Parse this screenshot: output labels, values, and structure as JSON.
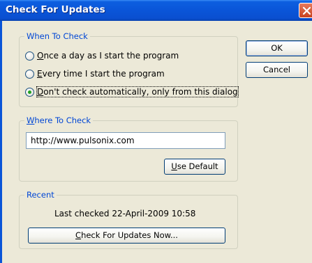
{
  "window": {
    "title": "Check For Updates"
  },
  "when_group": {
    "legend": "When To Check",
    "options": [
      {
        "mnemonic": "O",
        "rest": "nce a day as I start the program",
        "checked": false
      },
      {
        "mnemonic": "E",
        "rest": "very time I start the program",
        "checked": false
      },
      {
        "mnemonic": "D",
        "rest": "on't check automatically, only from this dialog",
        "checked": true
      }
    ]
  },
  "where_group": {
    "legend_mnemonic": "W",
    "legend_rest": "here To Check",
    "url_value": "http://www.pulsonix.com",
    "use_default": {
      "mnemonic": "U",
      "rest": "se Default"
    }
  },
  "recent_group": {
    "legend": "Recent",
    "last_checked": "Last checked 22-April-2009 10:58",
    "check_now": {
      "mnemonic": "C",
      "rest": "heck For Updates Now..."
    }
  },
  "buttons": {
    "ok": "OK",
    "cancel": "Cancel"
  },
  "icons": {
    "close": "close-icon"
  }
}
